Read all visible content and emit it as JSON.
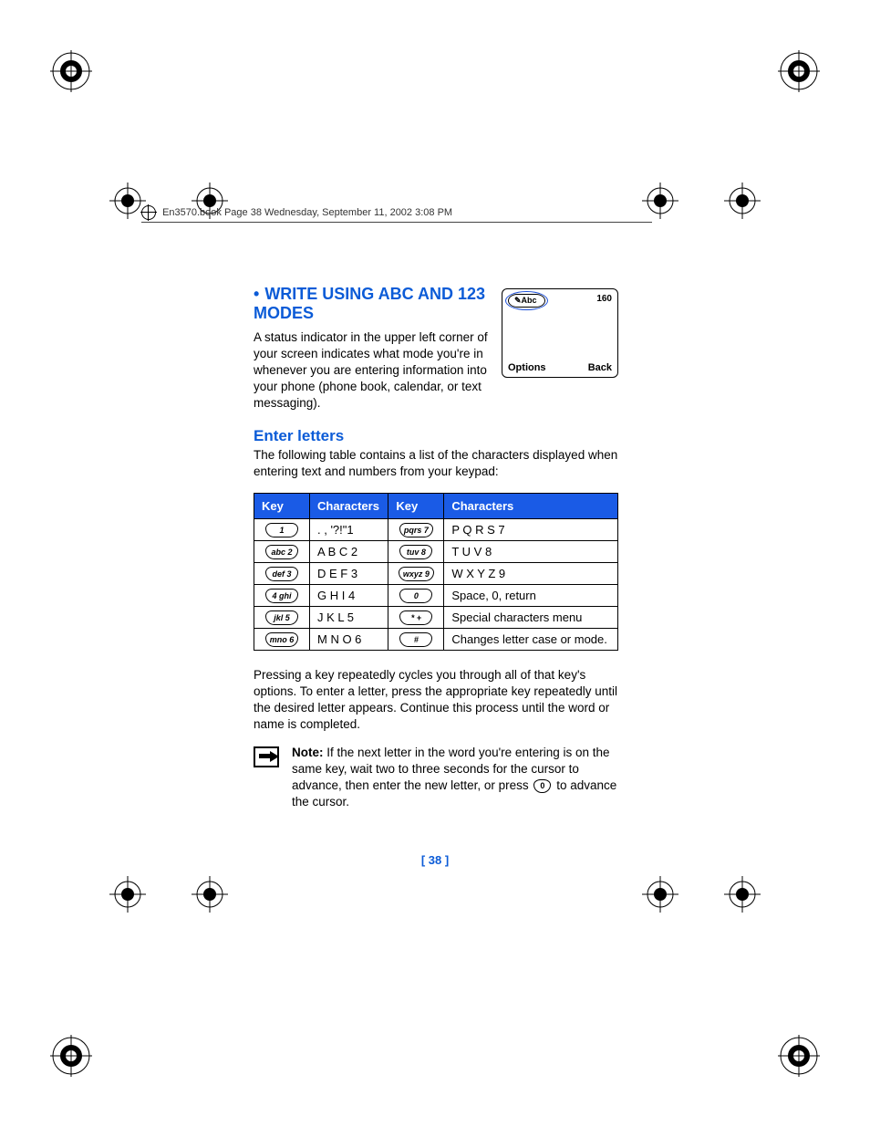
{
  "header_line": "En3570.book  Page 38  Wednesday, September 11, 2002  3:08 PM",
  "section_bullet": "•",
  "section_title": "WRITE USING ABC AND 123 MODES",
  "intro_paragraph": "A status indicator in the upper left corner of your screen indicates what mode you're in whenever you are entering information into your phone (phone book, calendar, or text messaging).",
  "screen": {
    "indicator": "Abc",
    "counter": "160",
    "soft_left": "Options",
    "soft_right": "Back"
  },
  "sub_heading": "Enter letters",
  "sub_intro": "The following table contains a list of the characters displayed when entering text and numbers from your keypad:",
  "table": {
    "headers": {
      "key1": "Key",
      "chars1": "Characters",
      "key2": "Key",
      "chars2": "Characters"
    },
    "rows": [
      {
        "k1": "1",
        "c1": ". , '?!\"1",
        "k2": "pqrs 7",
        "c2": "P Q R S 7"
      },
      {
        "k1": "abc 2",
        "c1": "A B C 2",
        "k2": "tuv 8",
        "c2": "T U V 8"
      },
      {
        "k1": "def 3",
        "c1": "D E F 3",
        "k2": "wxyz 9",
        "c2": "W X Y Z 9"
      },
      {
        "k1": "4 ghi",
        "c1": "G H I 4",
        "k2": "0",
        "c2": "Space, 0, return"
      },
      {
        "k1": "jkl 5",
        "c1": "J K L 5",
        "k2": "* +",
        "c2": "Special characters menu"
      },
      {
        "k1": "mno 6",
        "c1": "M N O 6",
        "k2": "#",
        "c2": "Changes letter case or mode."
      }
    ]
  },
  "after_table_paragraph": "Pressing a key repeatedly cycles you through all of that key's options. To enter a letter, press the appropriate key repeatedly until the desired letter appears. Continue this process until the word or name is completed.",
  "note": {
    "label": "Note:",
    "text_before_key": " If the next letter in the word you're entering is on the same key, wait two to three seconds for the cursor to advance, then enter the new letter, or press ",
    "inline_key_label": "0",
    "text_after_key": " to advance the cursor."
  },
  "page_number": "[ 38 ]"
}
